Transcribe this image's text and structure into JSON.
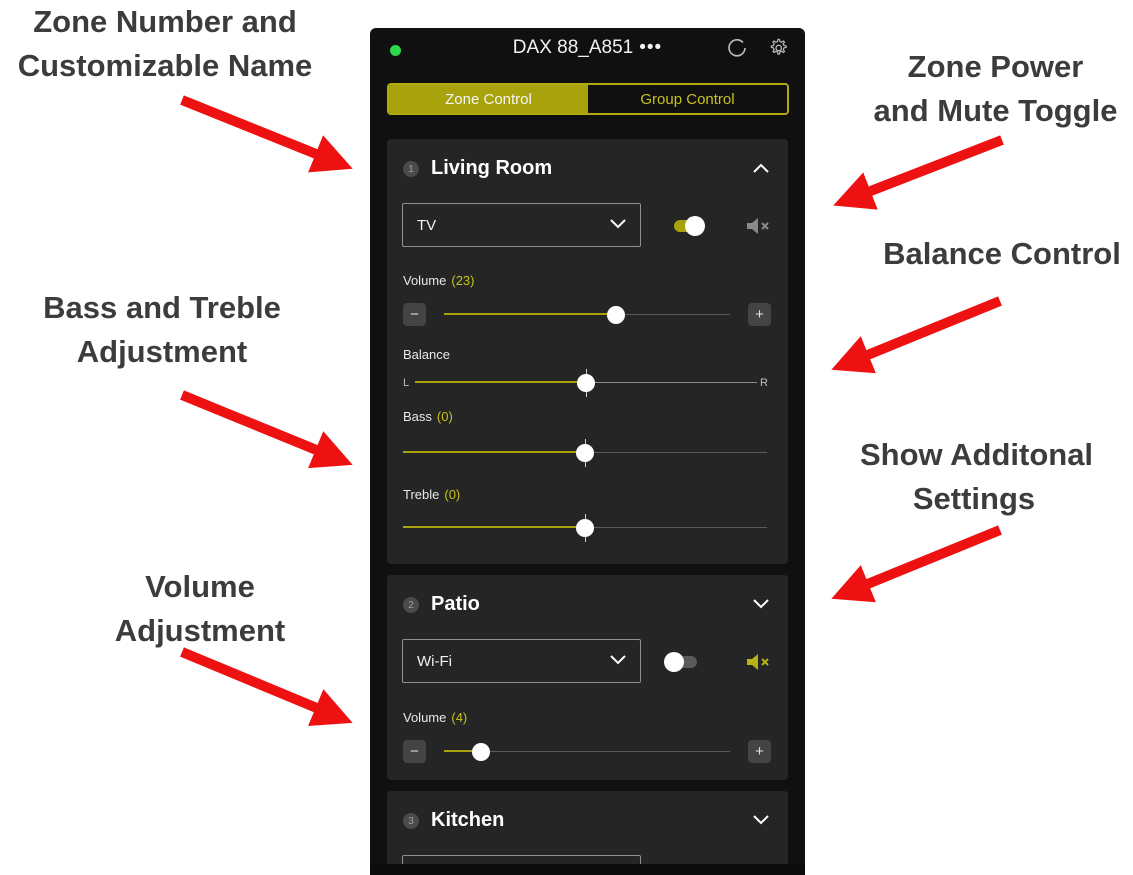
{
  "annotations": {
    "zone_number": [
      "Zone Number and",
      "Customizable Name"
    ],
    "power_mute": [
      "Zone Power",
      "and Mute Toggle"
    ],
    "balance": [
      "Balance Control"
    ],
    "bass_treble": [
      "Bass and Treble",
      "Adjustment"
    ],
    "additional": [
      "Show Additonal",
      "Settings"
    ],
    "volume": [
      "Volume",
      "Adjustment"
    ]
  },
  "header": {
    "device_name": "DAX 88_A851",
    "more": "•••"
  },
  "tabs": {
    "zone_control": "Zone Control",
    "group_control": "Group Control"
  },
  "zones": [
    {
      "number": "1",
      "name": "Living Room",
      "source": "TV",
      "power_on": true,
      "muted": false,
      "volume_label": "Volume",
      "volume_value": "(23)",
      "volume_level": 0.6,
      "balance_label": "Balance",
      "balance_left": "L",
      "balance_right": "R",
      "balance_level": 0.5,
      "bass_label": "Bass",
      "bass_value": "(0)",
      "bass_level": 0.5,
      "treble_label": "Treble",
      "treble_value": "(0)",
      "treble_level": 0.5
    },
    {
      "number": "2",
      "name": "Patio",
      "source": "Wi-Fi",
      "power_on": false,
      "muted": true,
      "volume_label": "Volume",
      "volume_value": "(4)",
      "volume_level": 0.13
    },
    {
      "number": "3",
      "name": "Kitchen"
    }
  ],
  "steppers": {
    "minus": "−",
    "plus": "+"
  },
  "colors": {
    "accent": "#a8a20d",
    "accent_text": "#c8c220",
    "status_online": "#2dd84b",
    "arrow": "#ee1111"
  },
  "icons": {
    "status": "status-dot",
    "refresh": "refresh-icon",
    "settings": "gear-icon",
    "expand": "chevron-icon",
    "mute": "speaker-mute-icon"
  }
}
